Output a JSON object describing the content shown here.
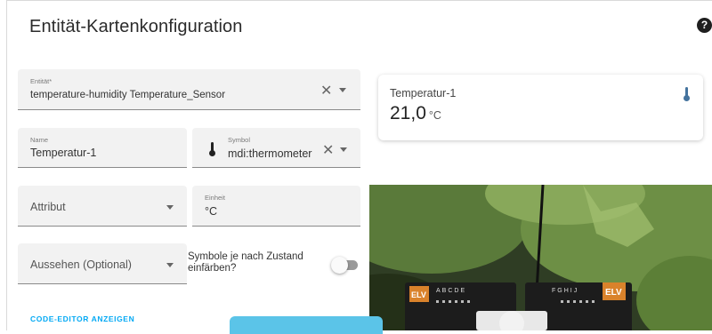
{
  "dialog": {
    "title": "Entität-Kartenkonfiguration",
    "help_icon": "help-circle-icon"
  },
  "form": {
    "entity": {
      "label": "Entität*",
      "value": "temperature-humidity Temperature_Sensor",
      "clear_icon": "close-icon",
      "dropdown_icon": "menu-down-icon"
    },
    "name": {
      "label": "Name",
      "value": "Temperatur-1"
    },
    "icon": {
      "label": "Symbol",
      "value": "mdi:thermometer",
      "leading_icon": "thermometer-icon",
      "clear_icon": "close-icon",
      "dropdown_icon": "menu-down-icon"
    },
    "attribute": {
      "placeholder": "Attribut",
      "dropdown_icon": "menu-down-icon"
    },
    "unit": {
      "label": "Einheit",
      "value": "°C"
    },
    "appearance": {
      "placeholder": "Aussehen (Optional)",
      "dropdown_icon": "menu-down-icon"
    },
    "state_color": {
      "label_line1": "Symbole je nach Zustand",
      "label_line2": "einfärben?",
      "checked": false
    },
    "code_editor_link": "CODE-EDITOR ANZEIGEN"
  },
  "preview": {
    "name": "Temperatur-1",
    "value": "21,0",
    "unit": "°C",
    "icon": "thermometer-icon",
    "icon_color": "#44739e"
  },
  "photo": {
    "board_labels": [
      "ELV",
      "ABCDE",
      "FGHIJ",
      "ELV"
    ]
  },
  "colors": {
    "accent": "#03a9f4",
    "field_bg": "#f2f2f2"
  }
}
